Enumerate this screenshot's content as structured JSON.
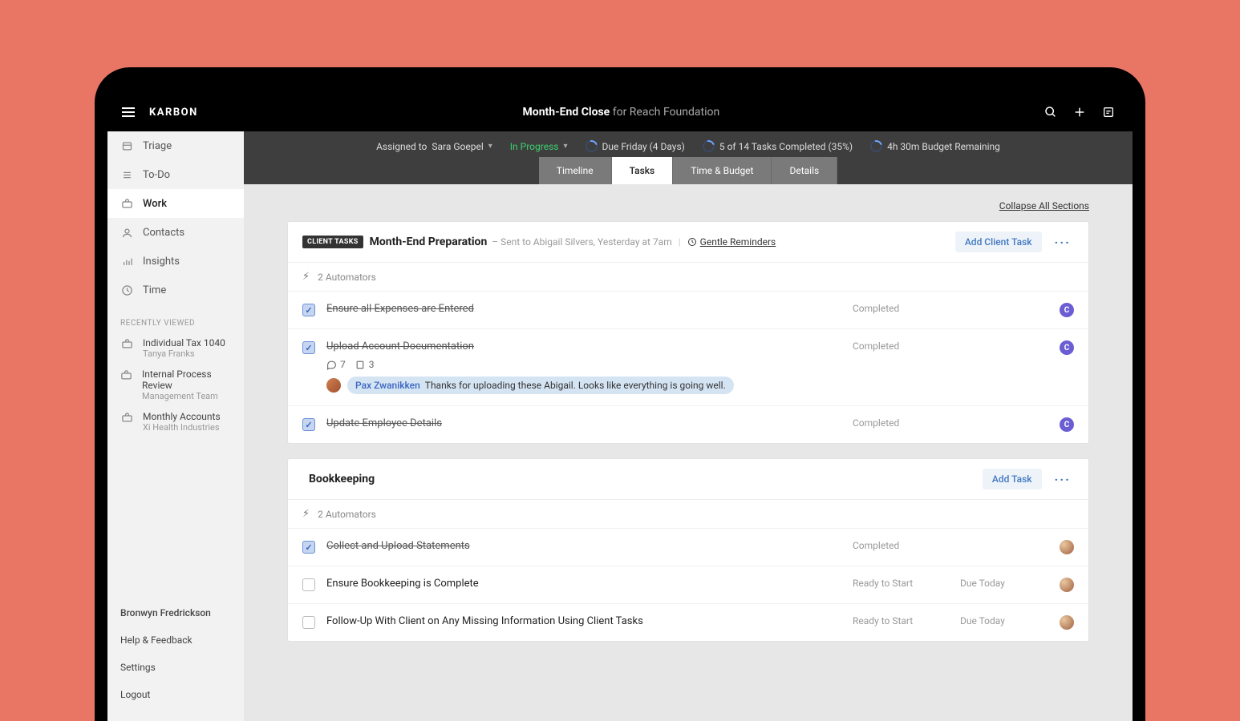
{
  "brand": "KARBON",
  "title": {
    "bold": "Month-End Close",
    "suffix": " for Reach Foundation"
  },
  "sidebar": {
    "nav": [
      {
        "label": "Triage",
        "icon": "triage-icon",
        "active": false
      },
      {
        "label": "To-Do",
        "icon": "todo-icon",
        "active": false
      },
      {
        "label": "Work",
        "icon": "work-icon",
        "active": true
      },
      {
        "label": "Contacts",
        "icon": "contacts-icon",
        "active": false
      },
      {
        "label": "Insights",
        "icon": "insights-icon",
        "active": false
      },
      {
        "label": "Time",
        "icon": "time-icon",
        "active": false
      }
    ],
    "recently_viewed_heading": "RECENTLY VIEWED",
    "recent": [
      {
        "title": "Individual Tax 1040",
        "sub": "Tanya Franks"
      },
      {
        "title": "Internal Process Review",
        "sub": "Management Team"
      },
      {
        "title": "Monthly Accounts",
        "sub": "Xi Health Industries"
      }
    ],
    "footer": [
      "Bronwyn Fredrickson",
      "Help & Feedback",
      "Settings",
      "Logout"
    ]
  },
  "subheader": {
    "assigned_label": "Assigned to ",
    "assigned_to": "Sara Goepel",
    "status_label": "In Progress",
    "due_label": "Due Friday (4 Days)",
    "tasks_label": "5 of 14 Tasks Completed (35%)",
    "budget_label": "4h 30m Budget Remaining",
    "tabs": [
      "Timeline",
      "Tasks",
      "Time & Budget",
      "Details"
    ],
    "active_tab": 1
  },
  "collapse_label": "Collapse All Sections",
  "sections": [
    {
      "badge": "CLIENT TASKS",
      "title": "Month-End Preparation",
      "subtitle": "– Sent to Abigail Silvers, Yesterday at 7am",
      "gentle": "Gentle Reminders",
      "add_btn": "Add Client Task",
      "automators": "2 Automators",
      "tasks": [
        {
          "text": "Ensure all Expenses are Entered",
          "done": true,
          "status": "Completed",
          "due": "",
          "avatar": "C"
        },
        {
          "text": "Upload Account Documentation",
          "done": true,
          "status": "Completed",
          "due": "",
          "avatar": "C",
          "comments": 7,
          "files": 3,
          "thread": {
            "author": "Pax Zwanikken",
            "text": "Thanks for uploading these Abigail. Looks like everything is going well."
          }
        },
        {
          "text": "Update Employee Details",
          "done": true,
          "status": "Completed",
          "due": "",
          "avatar": "C"
        }
      ]
    },
    {
      "badge": "",
      "title": "Bookkeeping",
      "subtitle": "",
      "gentle": "",
      "add_btn": "Add Task",
      "automators": "2 Automators",
      "tasks": [
        {
          "text": "Collect and Upload Statements",
          "done": true,
          "status": "Completed",
          "due": "",
          "avatar": "img"
        },
        {
          "text": "Ensure Bookkeeping is Complete",
          "done": false,
          "status": "Ready to Start",
          "due": "Due Today",
          "avatar": "img"
        },
        {
          "text": "Follow-Up With Client on Any Missing Information Using Client Tasks",
          "done": false,
          "status": "Ready to Start",
          "due": "Due Today",
          "avatar": "img"
        }
      ]
    }
  ]
}
